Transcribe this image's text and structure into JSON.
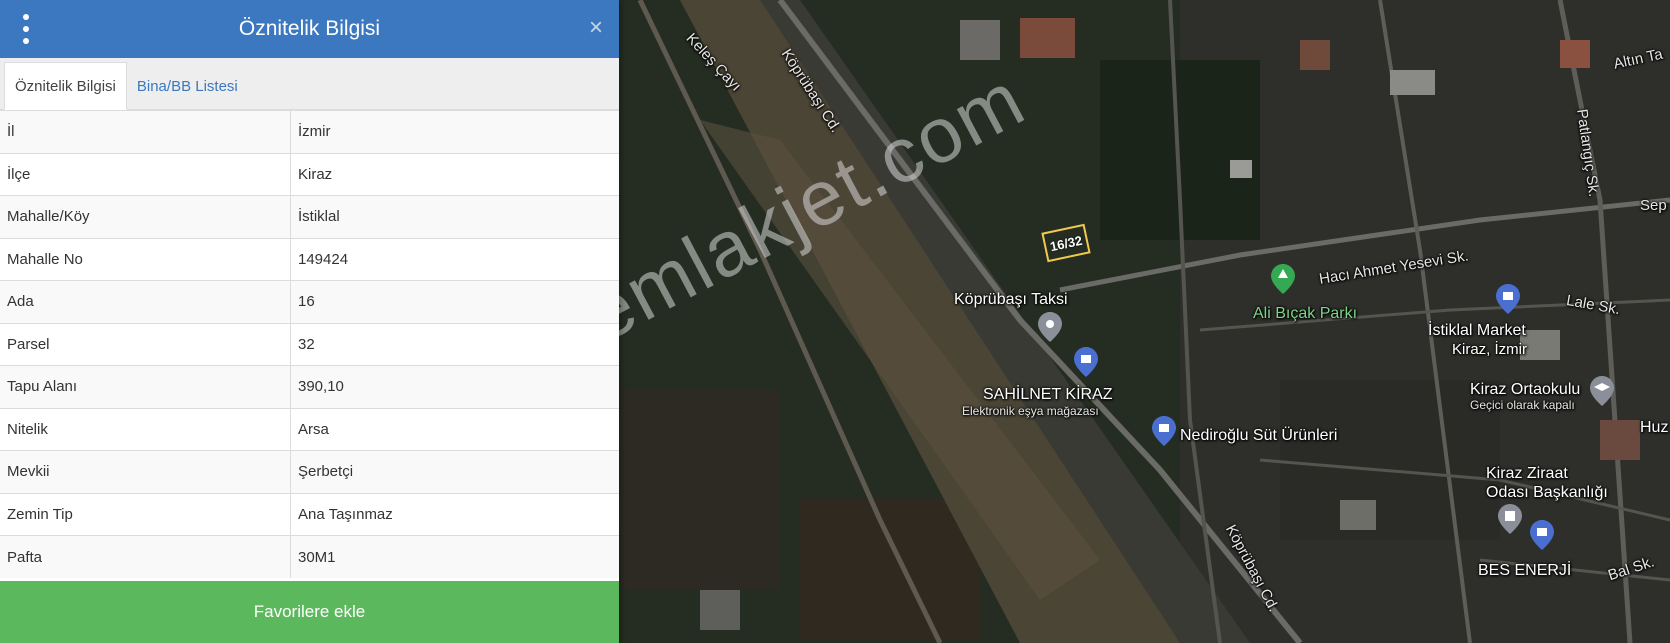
{
  "panel": {
    "title": "Öznitelik Bilgisi",
    "close_icon": "×",
    "tabs": [
      {
        "label": "Öznitelik Bilgisi",
        "active": true
      },
      {
        "label": "Bina/BB Listesi",
        "active": false
      }
    ],
    "rows": [
      {
        "key": "İl",
        "value": "İzmir"
      },
      {
        "key": "İlçe",
        "value": "Kiraz"
      },
      {
        "key": "Mahalle/Köy",
        "value": "İstiklal"
      },
      {
        "key": "Mahalle No",
        "value": "149424"
      },
      {
        "key": "Ada",
        "value": "16"
      },
      {
        "key": "Parsel",
        "value": "32"
      },
      {
        "key": "Tapu Alanı",
        "value": "390,10"
      },
      {
        "key": "Nitelik",
        "value": "Arsa"
      },
      {
        "key": "Mevkii",
        "value": "Şerbetçi"
      },
      {
        "key": "Zemin Tip",
        "value": "Ana Taşınmaz"
      },
      {
        "key": "Pafta",
        "value": "30M1"
      }
    ],
    "favorite_button": "Favorilere ekle"
  },
  "map": {
    "watermark": "emlakjet.com",
    "parcel_label": "16/32",
    "labels": {
      "keles_cayi": "Keleş Çayı",
      "koprubasi_cd_top": "Köprübaşı Cd.",
      "koprubasi_cd_bottom": "Köprübaşı Cd.",
      "altin": "Altın Ta",
      "patlangic": "Patlangıç Sk.",
      "sep": "Sep",
      "haci_ahmet": "Hacı Ahmet Yesevi Sk.",
      "lale": "Lale Sk.",
      "ali_bicak": "Ali Bıçak Parkı",
      "koprubasi_taksi": "Köprübaşı Taksi",
      "istiklal_market_1": "İstiklal Market",
      "istiklal_market_2": "Kiraz, İzmir",
      "sahilnet": "SAHİLNET KİRAZ",
      "elektronik": "Elektronik eşya mağazası",
      "kiraz_ortaokulu": "Kiraz Ortaokulu",
      "gecici": "Geçici olarak kapalı",
      "nediroglu": "Nediroğlu Süt Ürünleri",
      "huz": "Huz",
      "ziraat_1": "Kiraz Ziraat",
      "ziraat_2": "Odası Başkanlığı",
      "bes_enerji": "BES ENERJİ",
      "bal": "Bal Sk."
    },
    "colors": {
      "panel_header": "#3b78c0",
      "favorite_button": "#5cb85c",
      "park_pin": "#34a853",
      "shop_pin": "#4a6fd1",
      "parcel_outline": "#f2c94c"
    }
  }
}
